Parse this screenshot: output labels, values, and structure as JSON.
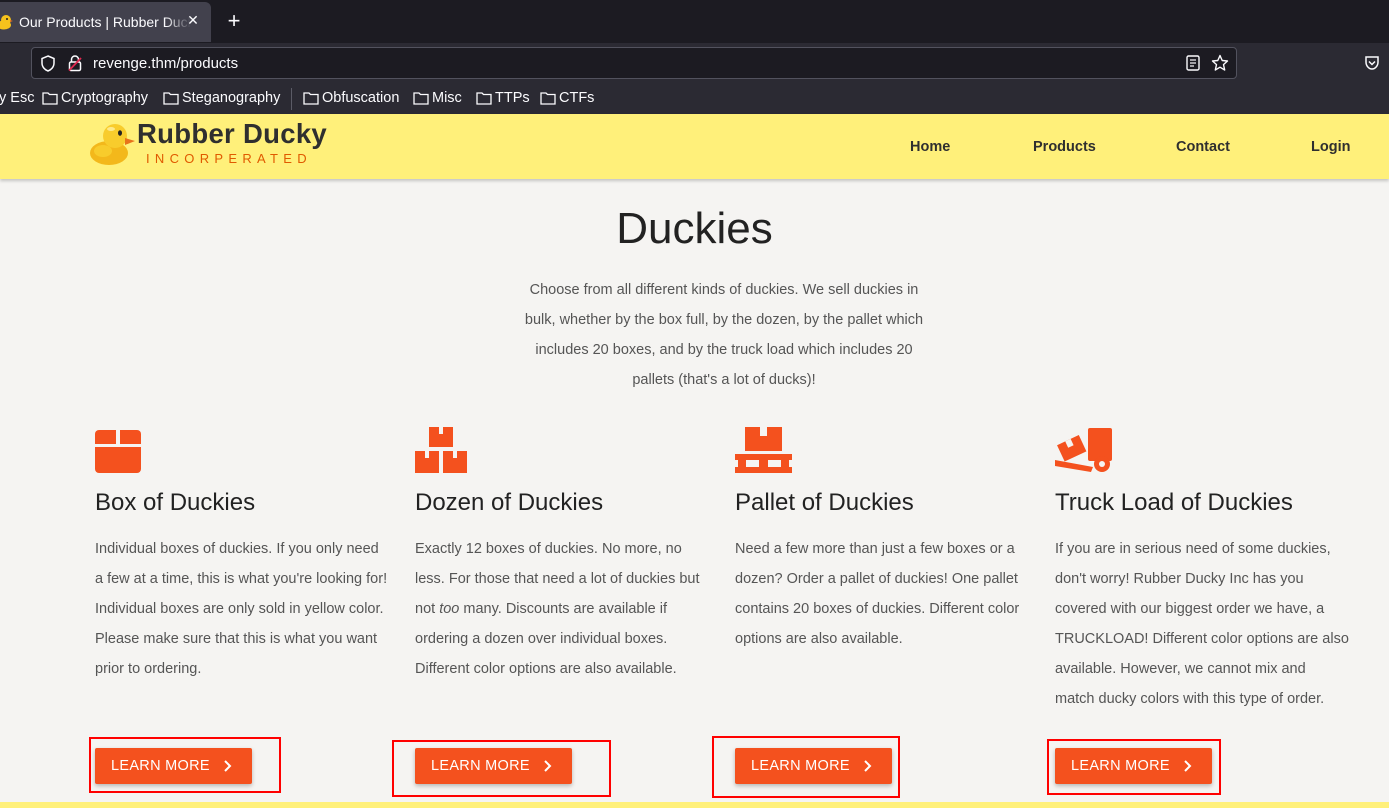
{
  "browser": {
    "tab_title": "Our Products | Rubber Ducky Inc",
    "url": "revenge.thm/products",
    "bookmarks": [
      "y Esc",
      "Cryptography",
      "Steganography",
      "Obfuscation",
      "Misc",
      "TTPs",
      "CTFs"
    ]
  },
  "site": {
    "brand_name": "Rubber Ducky",
    "brand_sub": "INCORPERATED",
    "nav": [
      "Home",
      "Products",
      "Contact",
      "Login"
    ]
  },
  "page": {
    "title": "Duckies",
    "intro_lines": [
      "Choose from all different kinds of duckies. We sell duckies in",
      "bulk, whether by the box full, by the dozen, by the pallet which",
      "includes 20 boxes, and by the truck load which includes 20",
      "pallets (that's a lot of ducks)!"
    ]
  },
  "cards": [
    {
      "icon": "box-icon",
      "title": "Box of Duckies",
      "desc_lines": [
        "Individual boxes of duckies. If you only need",
        "a few at a time, this is what you're looking for!",
        "Individual boxes are only sold in yellow color.",
        "Please make sure that this is what you want",
        "prior to ordering."
      ],
      "button": "LEARN MORE"
    },
    {
      "icon": "boxes-icon",
      "title": "Dozen of Duckies",
      "desc_lines": [
        "Exactly 12 boxes of duckies. No more, no",
        "less. For those that need a lot of duckies but",
        "not too many. Discounts are available if",
        "ordering a dozen over individual boxes.",
        "Different color options are also available."
      ],
      "button": "LEARN MORE"
    },
    {
      "icon": "pallet-icon",
      "title": "Pallet of Duckies",
      "desc_lines": [
        "Need a few more than just a few boxes or a",
        "dozen? Order a pallet of duckies! One pallet",
        "contains 20 boxes of duckies. Different color",
        "options are also available."
      ],
      "button": "LEARN MORE"
    },
    {
      "icon": "dolly-icon",
      "title": "Truck Load of Duckies",
      "desc_lines": [
        "If you are in serious need of some duckies,",
        "don't worry! Rubber Ducky Inc has you",
        "covered with our biggest order we have, a",
        "TRUCKLOAD! Different color options are also",
        "available. However, we cannot mix and",
        "match ducky colors with this type of order."
      ],
      "button": "LEARN MORE"
    }
  ],
  "colors": {
    "accent": "#f4511e",
    "header_bg": "#fff07a",
    "highlight": "#ff0000"
  }
}
